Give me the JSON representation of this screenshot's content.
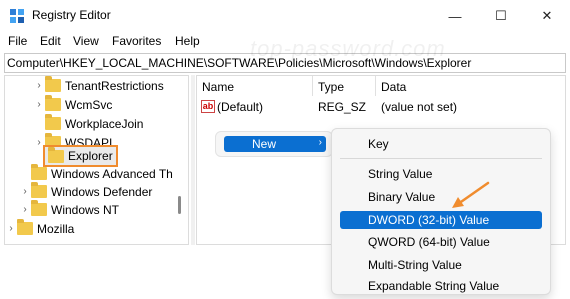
{
  "window": {
    "title": "Registry Editor",
    "minimize_glyph": "—",
    "maximize_glyph": "☐",
    "close_glyph": "✕"
  },
  "menubar": [
    "File",
    "Edit",
    "View",
    "Favorites",
    "Help"
  ],
  "address": "Computer\\HKEY_LOCAL_MACHINE\\SOFTWARE\\Policies\\Microsoft\\Windows\\Explorer",
  "watermark": "top-password.com",
  "tree": [
    {
      "label": "TenantRestrictions",
      "chevron": "›"
    },
    {
      "label": "WcmSvc",
      "chevron": "›"
    },
    {
      "label": "WorkplaceJoin",
      "chevron": ""
    },
    {
      "label": "WSDAPI",
      "chevron": "›"
    },
    {
      "label": "Explorer",
      "chevron": "",
      "selected": true
    },
    {
      "label": "Windows Advanced Th",
      "chevron": ""
    },
    {
      "label": "Windows Defender",
      "chevron": "›"
    },
    {
      "label": "Windows NT",
      "chevron": "›"
    },
    {
      "label": "Mozilla",
      "chevron": "›"
    }
  ],
  "list": {
    "columns": [
      "Name",
      "Type",
      "Data"
    ],
    "rows": [
      {
        "icon": "ab",
        "name": "(Default)",
        "type": "REG_SZ",
        "data": "(value not set)"
      }
    ]
  },
  "context_menu": {
    "item": "New",
    "arrow": "›"
  },
  "submenu": {
    "items": [
      "Key",
      "String Value",
      "Binary Value",
      "DWORD (32-bit) Value",
      "QWORD (64-bit) Value",
      "Multi-String Value",
      "Expandable String Value"
    ],
    "highlighted": "DWORD (32-bit) Value"
  },
  "colors": {
    "accent": "#0b6fd1",
    "selection_outline": "#f08c2e",
    "folder": "#f2c94c"
  },
  "icons": [
    "registry-editor-icon",
    "folder-icon",
    "string-value-icon",
    "orange-arrow-icon"
  ]
}
